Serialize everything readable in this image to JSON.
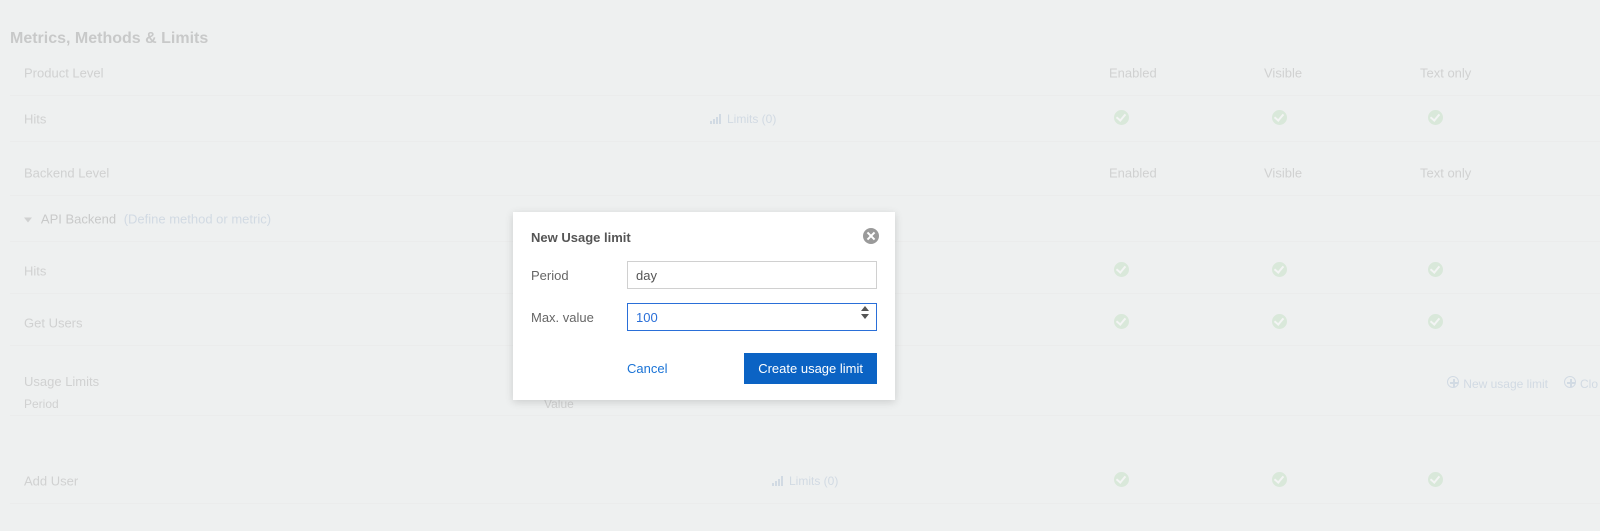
{
  "page_title": "Metrics, Methods & Limits",
  "columns": {
    "enabled": "Enabled",
    "visible": "Visible",
    "text_only": "Text only"
  },
  "product_section": {
    "label": "Product Level"
  },
  "product_row": {
    "name": "Hits",
    "limits": "Limits (0)"
  },
  "backend_section": {
    "label": "Backend Level"
  },
  "api_backend": {
    "name": "API Backend",
    "define": "(Define method or metric)"
  },
  "backend_rows": [
    {
      "name": "Hits"
    },
    {
      "name": "Get Users"
    }
  ],
  "usage": {
    "label": "Usage Limits",
    "period": "Period",
    "value": "Value",
    "new_link": "New usage limit",
    "close_link": "Clo"
  },
  "add_user_row": {
    "name": "Add User",
    "limits": "Limits (0)"
  },
  "modal": {
    "title": "New Usage limit",
    "period_label": "Period",
    "period_value": "day",
    "max_label": "Max. value",
    "max_value": "100",
    "cancel": "Cancel",
    "submit": "Create usage limit"
  }
}
